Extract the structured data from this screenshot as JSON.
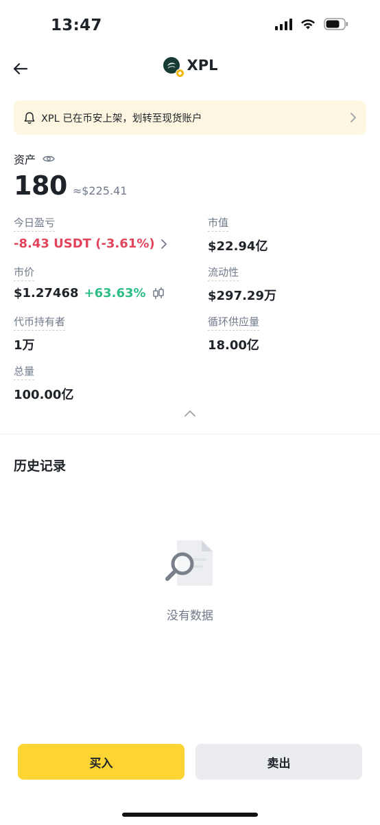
{
  "status_bar": {
    "time": "13:47"
  },
  "nav": {
    "title": "XPL"
  },
  "banner": {
    "text": "XPL 已在币安上架，划转至现货账户"
  },
  "assets": {
    "label": "资产",
    "amount": "180",
    "usd_value": "≈$225.41"
  },
  "stats": {
    "today_pnl": {
      "label": "今日盈亏",
      "value": "-8.43 USDT (-3.61%)"
    },
    "market_cap": {
      "label": "市值",
      "value": "$22.94亿"
    },
    "price": {
      "label": "市价",
      "value": "$1.27468",
      "change": "+63.63%"
    },
    "liquidity": {
      "label": "流动性",
      "value": "$297.29万"
    },
    "holders": {
      "label": "代币持有者",
      "value": "1万"
    },
    "circulating_supply": {
      "label": "循环供应量",
      "value": "18.00亿"
    },
    "total_supply": {
      "label": "总量",
      "value": "100.00亿"
    }
  },
  "history": {
    "title": "历史记录",
    "empty_text": "没有数据"
  },
  "actions": {
    "buy": "买入",
    "sell": "卖出"
  },
  "colors": {
    "accent": "#fcd535",
    "negative": "#e2445c",
    "positive": "#2ebd85",
    "banner_bg": "#fdf7e2"
  },
  "icons": [
    "back-arrow-icon",
    "bell-icon",
    "chevron-right-icon",
    "eye-icon",
    "candlestick-icon",
    "chevron-up-icon",
    "search-document-icon"
  ]
}
